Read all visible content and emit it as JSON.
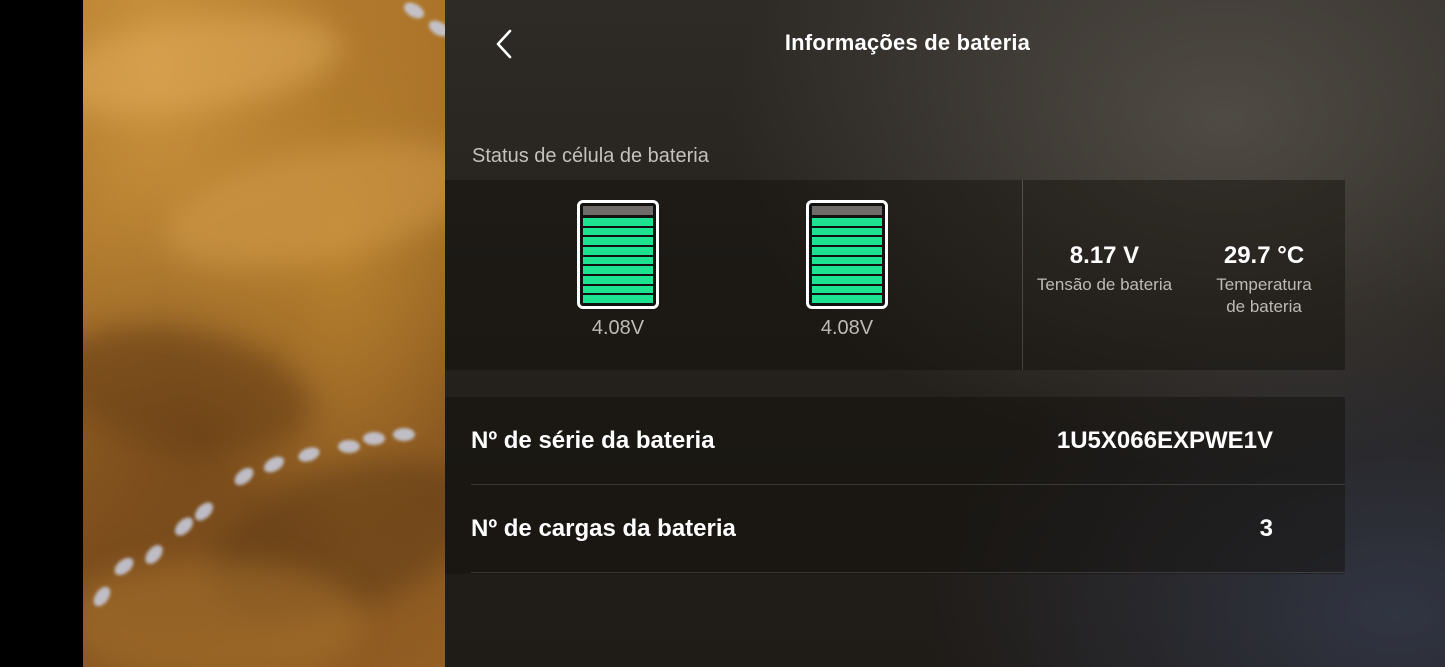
{
  "header": {
    "title": "Informações de bateria",
    "back_icon": "chevron-left-icon"
  },
  "cell_status": {
    "label": "Status de célula de bateria",
    "cells": [
      {
        "voltage": "4.08V",
        "charge_level": 1.0,
        "color": "#1de28f"
      },
      {
        "voltage": "4.08V",
        "charge_level": 1.0,
        "color": "#1de28f"
      }
    ]
  },
  "stats": {
    "voltage": {
      "value": "8.17 V",
      "label": "Tensão de bateria"
    },
    "temperature": {
      "value": "29.7 °C",
      "label_line1": "Temperatura",
      "label_line2": "de bateria"
    }
  },
  "info": {
    "serial": {
      "label": "Nº de série da bateria",
      "value": "1U5X066EXPWE1V"
    },
    "charges": {
      "label": "Nº de cargas da bateria",
      "value": "3"
    }
  }
}
